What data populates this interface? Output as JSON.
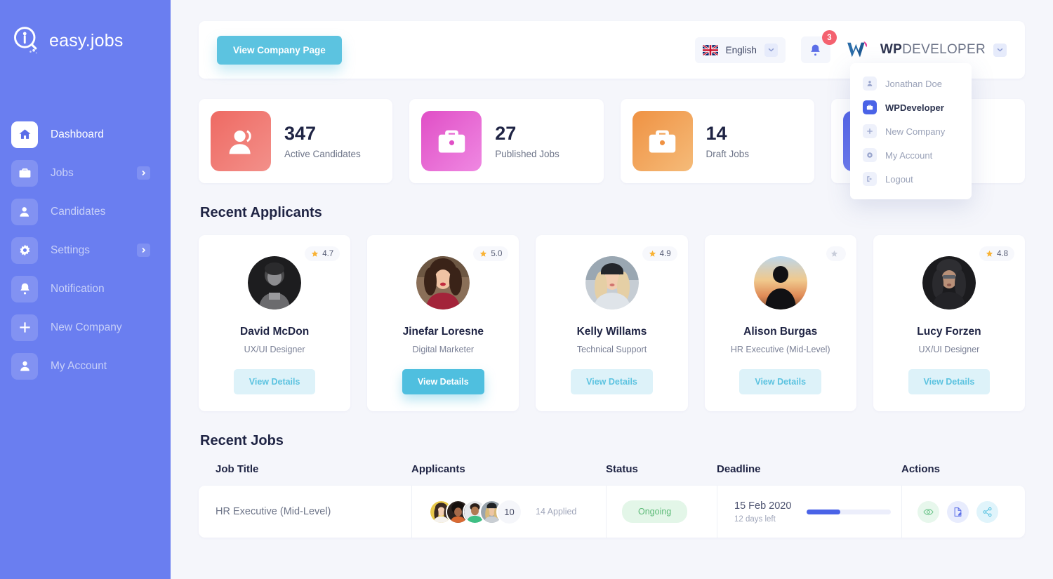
{
  "brand": {
    "name": "easy.jobs",
    "logo_icon": "magnifier-person-logo"
  },
  "sidebar": {
    "items": [
      {
        "label": "Dashboard",
        "icon": "home-icon",
        "active": true,
        "chevron": false
      },
      {
        "label": "Jobs",
        "icon": "briefcase-icon",
        "active": false,
        "chevron": true
      },
      {
        "label": "Candidates",
        "icon": "user-icon",
        "active": false,
        "chevron": false
      },
      {
        "label": "Settings",
        "icon": "gear-icon",
        "active": false,
        "chevron": true
      },
      {
        "label": "Notification",
        "icon": "bell-icon",
        "active": false,
        "chevron": false
      },
      {
        "label": "New Company",
        "icon": "plus-icon",
        "active": false,
        "chevron": false
      },
      {
        "label": "My Account",
        "icon": "person-icon",
        "active": false,
        "chevron": false
      }
    ]
  },
  "topbar": {
    "company_button": "View Company Page",
    "language": {
      "value": "English",
      "flag": "uk-flag-icon",
      "chevron_icon": "chevron-down-icon"
    },
    "notifications": {
      "icon": "bell-icon",
      "count": "3"
    },
    "account": {
      "logo_icon": "wpdeveloper-logo",
      "name_bold": "WP",
      "name_rest": "DEVELOPER",
      "chevron_icon": "chevron-down-icon"
    }
  },
  "account_dropdown": {
    "items": [
      {
        "label": "Jonathan Doe",
        "icon": "person-icon",
        "active": false
      },
      {
        "label": "WPDeveloper",
        "icon": "briefcase-icon",
        "active": true
      },
      {
        "label": "New Company",
        "icon": "plus-icon",
        "active": false
      },
      {
        "label": "My Account",
        "icon": "gear-icon",
        "active": false
      },
      {
        "label": "Logout",
        "icon": "logout-icon",
        "active": false
      }
    ]
  },
  "stats": [
    {
      "value": "347",
      "label": "Active Candidates",
      "icon": "users-icon",
      "color_from": "#ef6a63",
      "color_to": "#f08683"
    },
    {
      "value": "27",
      "label": "Published Jobs",
      "icon": "briefcase-icon",
      "color_from": "#e355c8",
      "color_to": "#ee7fe0"
    },
    {
      "value": "14",
      "label": "Draft Jobs",
      "icon": "briefcase-icon",
      "color_from": "#ef9448",
      "color_to": "#f3b471"
    },
    {
      "value": "",
      "label": "",
      "icon": "group-icon",
      "color_from": "#5665e8",
      "color_to": "#7b88f2"
    }
  ],
  "recent_applicants": {
    "title": "Recent Applicants",
    "cards": [
      {
        "name": "David McDon",
        "role": "UX/UI Designer",
        "rating": "4.7",
        "has_rating": true,
        "button": "View Details",
        "primary": false,
        "avatar_style": "photo-male-curly"
      },
      {
        "name": "Jinefar Loresne",
        "role": "Digital Marketer",
        "rating": "5.0",
        "has_rating": true,
        "button": "View Details",
        "primary": true,
        "avatar_style": "photo-female-red"
      },
      {
        "name": "Kelly Willams",
        "role": "Technical Support",
        "rating": "4.9",
        "has_rating": true,
        "button": "View Details",
        "primary": false,
        "avatar_style": "photo-female-beanie"
      },
      {
        "name": "Alison Burgas",
        "role": "HR Executive (Mid-Level)",
        "rating": "",
        "has_rating": false,
        "button": "View Details",
        "primary": false,
        "avatar_style": "photo-sunset-hood"
      },
      {
        "name": "Lucy Forzen",
        "role": "UX/UI Designer",
        "rating": "4.8",
        "has_rating": true,
        "button": "View Details",
        "primary": false,
        "avatar_style": "photo-female-dark"
      }
    ]
  },
  "recent_jobs": {
    "title": "Recent Jobs",
    "columns": [
      "Job Title",
      "Applicants",
      "Status",
      "Deadline",
      "Actions"
    ],
    "rows": [
      {
        "job_title": "HR Executive (Mid-Level)",
        "avatar_count": 4,
        "more_count": "10",
        "applied_text": "14 Applied",
        "status": "Ongoing",
        "status_color": "#5cba77",
        "deadline_date": "15 Feb 2020",
        "deadline_left": "12 days left",
        "progress_percent": 40,
        "actions": [
          "eye-icon",
          "edit-document-icon",
          "share-icon"
        ]
      }
    ]
  }
}
